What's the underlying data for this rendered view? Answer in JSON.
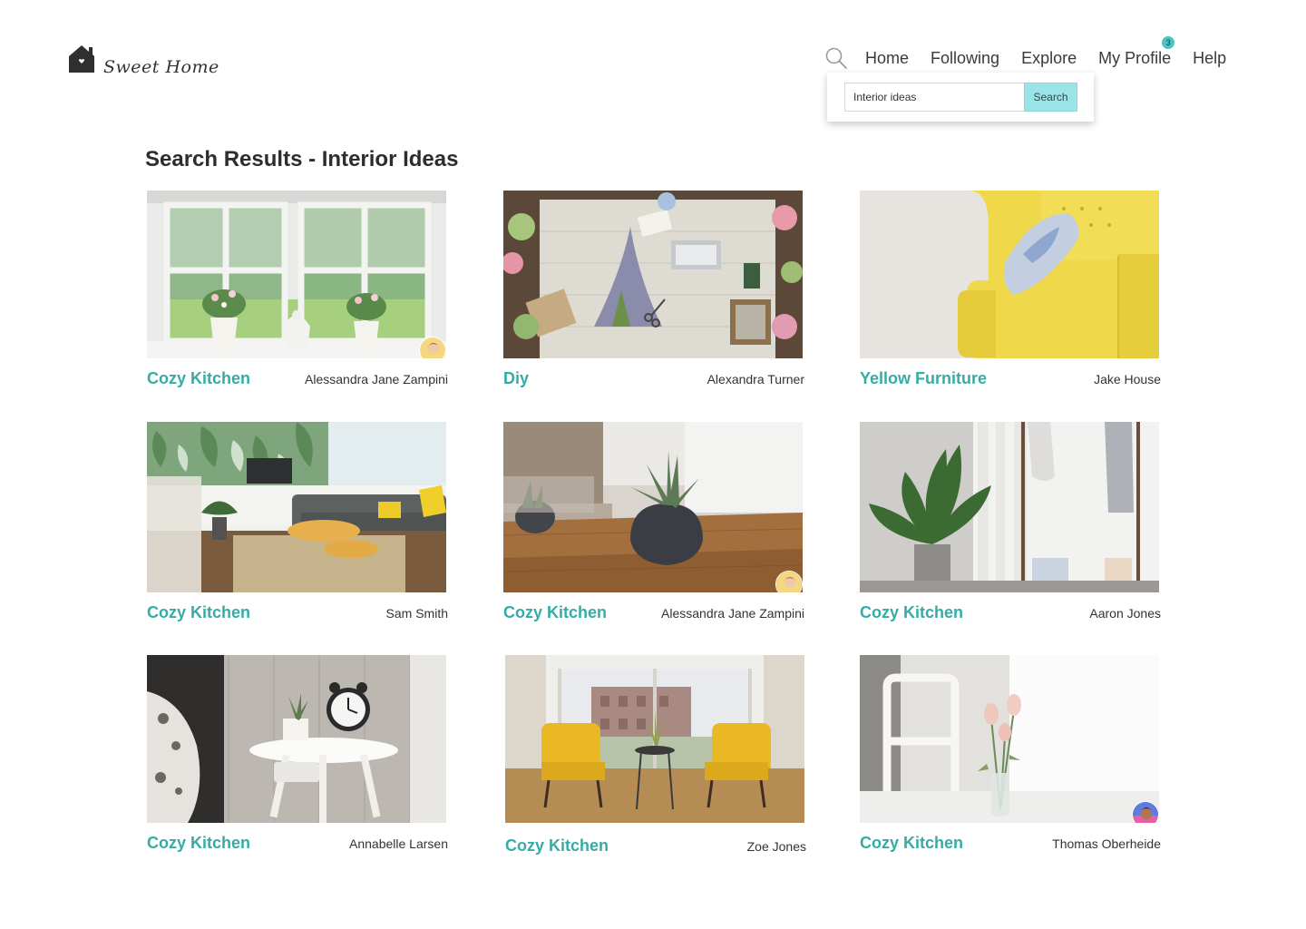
{
  "brand": {
    "name": "Sweet Home",
    "icon": "house-icon"
  },
  "nav": {
    "items": [
      {
        "label": "Home"
      },
      {
        "label": "Following"
      },
      {
        "label": "Explore"
      },
      {
        "label": "My Profile",
        "badge": "3"
      },
      {
        "label": "Help"
      }
    ],
    "search_icon": "search-icon"
  },
  "search": {
    "value": "Interior ideas",
    "button_label": "Search"
  },
  "results": {
    "heading_bold": "Search Results -",
    "heading_term": "Interior Ideas",
    "cards": [
      {
        "title": "Cozy Kitchen",
        "author": "Alessandra Jane Zampini",
        "image": "window-plants-photo",
        "has_avatar": true
      },
      {
        "title": "Diy",
        "author": "Alexandra Turner",
        "image": "craft-table-photo",
        "has_avatar": false
      },
      {
        "title": "Yellow Furniture",
        "author": "Jake House",
        "image": "yellow-sofa-photo",
        "has_avatar": false
      },
      {
        "title": "Cozy Kitchen",
        "author": "Sam Smith",
        "image": "living-room-photo",
        "has_avatar": false
      },
      {
        "title": "Cozy Kitchen",
        "author": "Alessandra Jane Zampini",
        "image": "succulent-table-photo",
        "has_avatar": true
      },
      {
        "title": "Cozy Kitchen",
        "author": "Aaron Jones",
        "image": "plant-clothes-rack-photo",
        "has_avatar": false
      },
      {
        "title": "Cozy Kitchen",
        "author": "Annabelle Larsen",
        "image": "bedside-clock-photo",
        "has_avatar": false
      },
      {
        "title": "Cozy Kitchen",
        "author": "Zoe Jones",
        "image": "yellow-chairs-photo",
        "has_avatar": false
      },
      {
        "title": "Cozy Kitchen",
        "author": "Thomas Oberheide",
        "image": "roses-vase-photo",
        "has_avatar": true
      }
    ]
  },
  "colors": {
    "accent": "#35aca5",
    "search_button": "#9ae3e8",
    "badge": "#49c5c4"
  }
}
